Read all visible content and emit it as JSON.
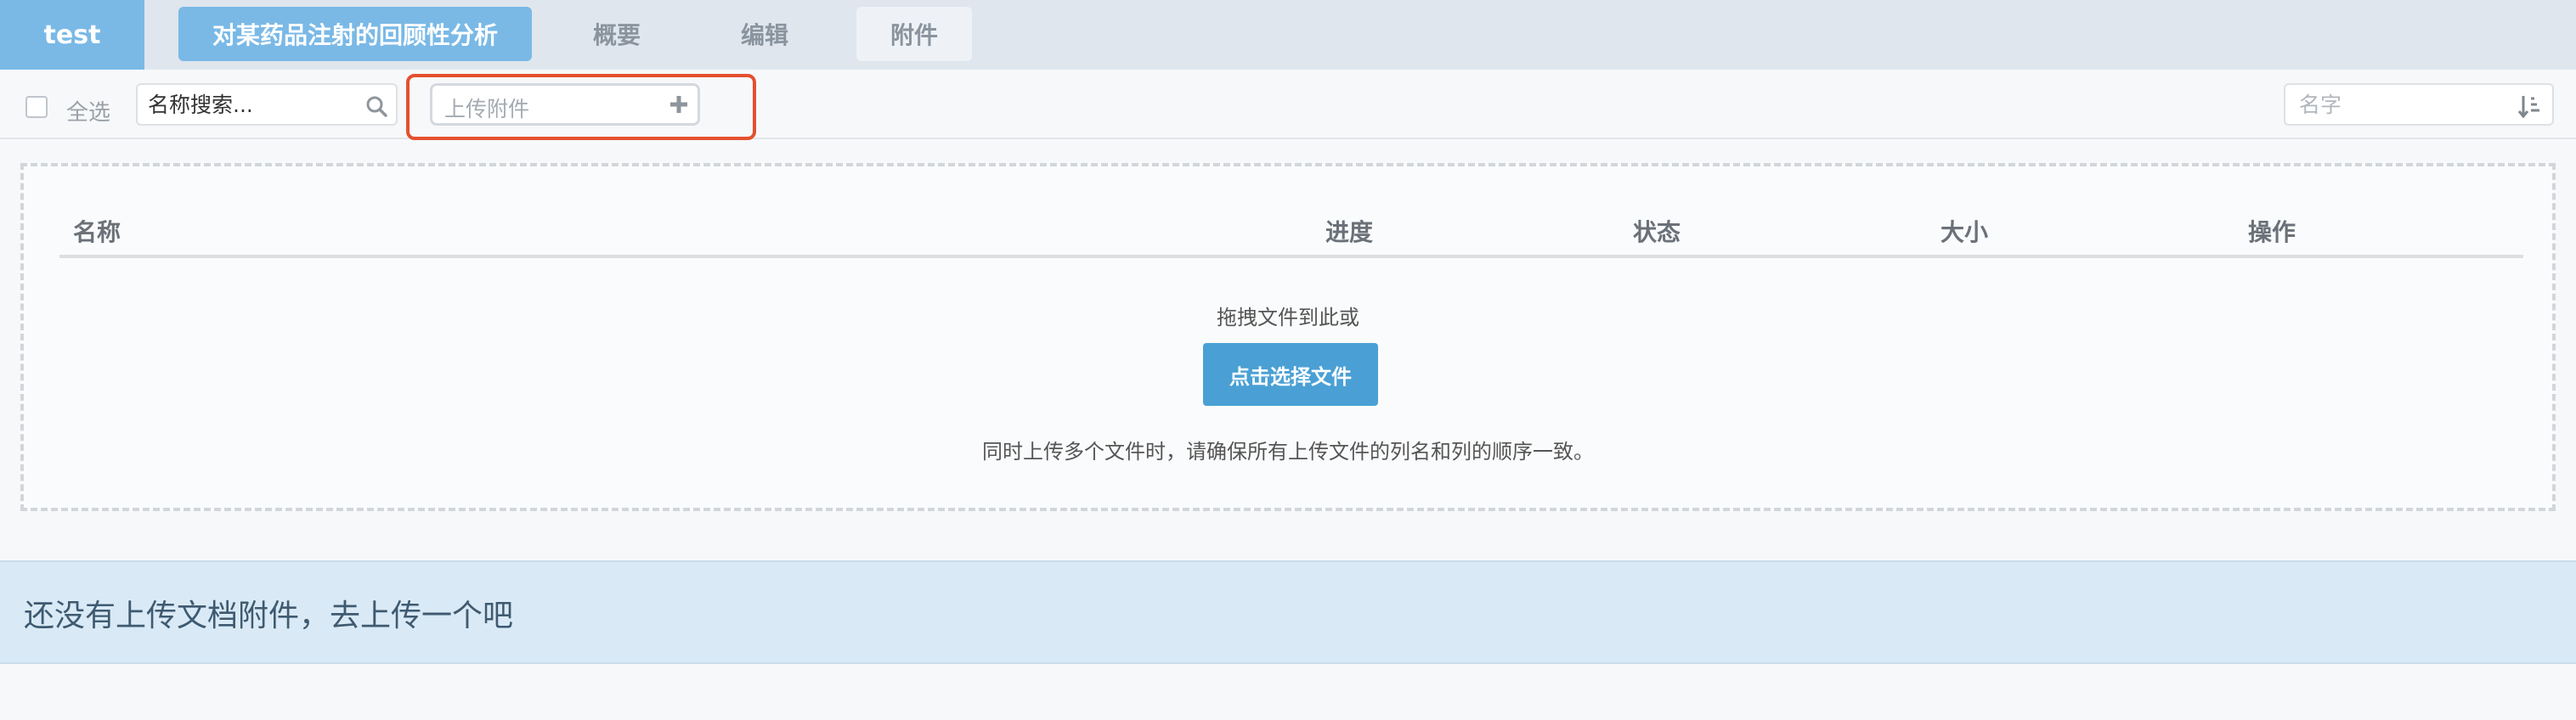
{
  "nav": {
    "brand": "test",
    "tabs": [
      {
        "label": "对某药品注射的回顾性分析",
        "active": true
      },
      {
        "label": "概要"
      },
      {
        "label": "编辑"
      },
      {
        "label": "附件",
        "selected": true
      }
    ]
  },
  "toolbar": {
    "select_all_label": "全选",
    "search_placeholder": "名称搜索...",
    "upload_label": "上传附件",
    "sort_placeholder": "名字"
  },
  "dropzone": {
    "columns": [
      "名称",
      "进度",
      "状态",
      "大小",
      "操作"
    ],
    "drop_hint": "拖拽文件到此或",
    "choose_button": "点击选择文件",
    "multi_hint": "同时上传多个文件时，请确保所有上传文件的列名和列的顺序一致。"
  },
  "notice": {
    "text": "还没有上传文档附件，去上传一个吧"
  },
  "colors": {
    "accent": "#7ab9e6",
    "button": "#4aa0d4",
    "highlight": "#e5502f",
    "notice_bg": "#d9eaf6"
  },
  "icons": [
    "search-icon",
    "plus-icon",
    "sort-icon"
  ]
}
